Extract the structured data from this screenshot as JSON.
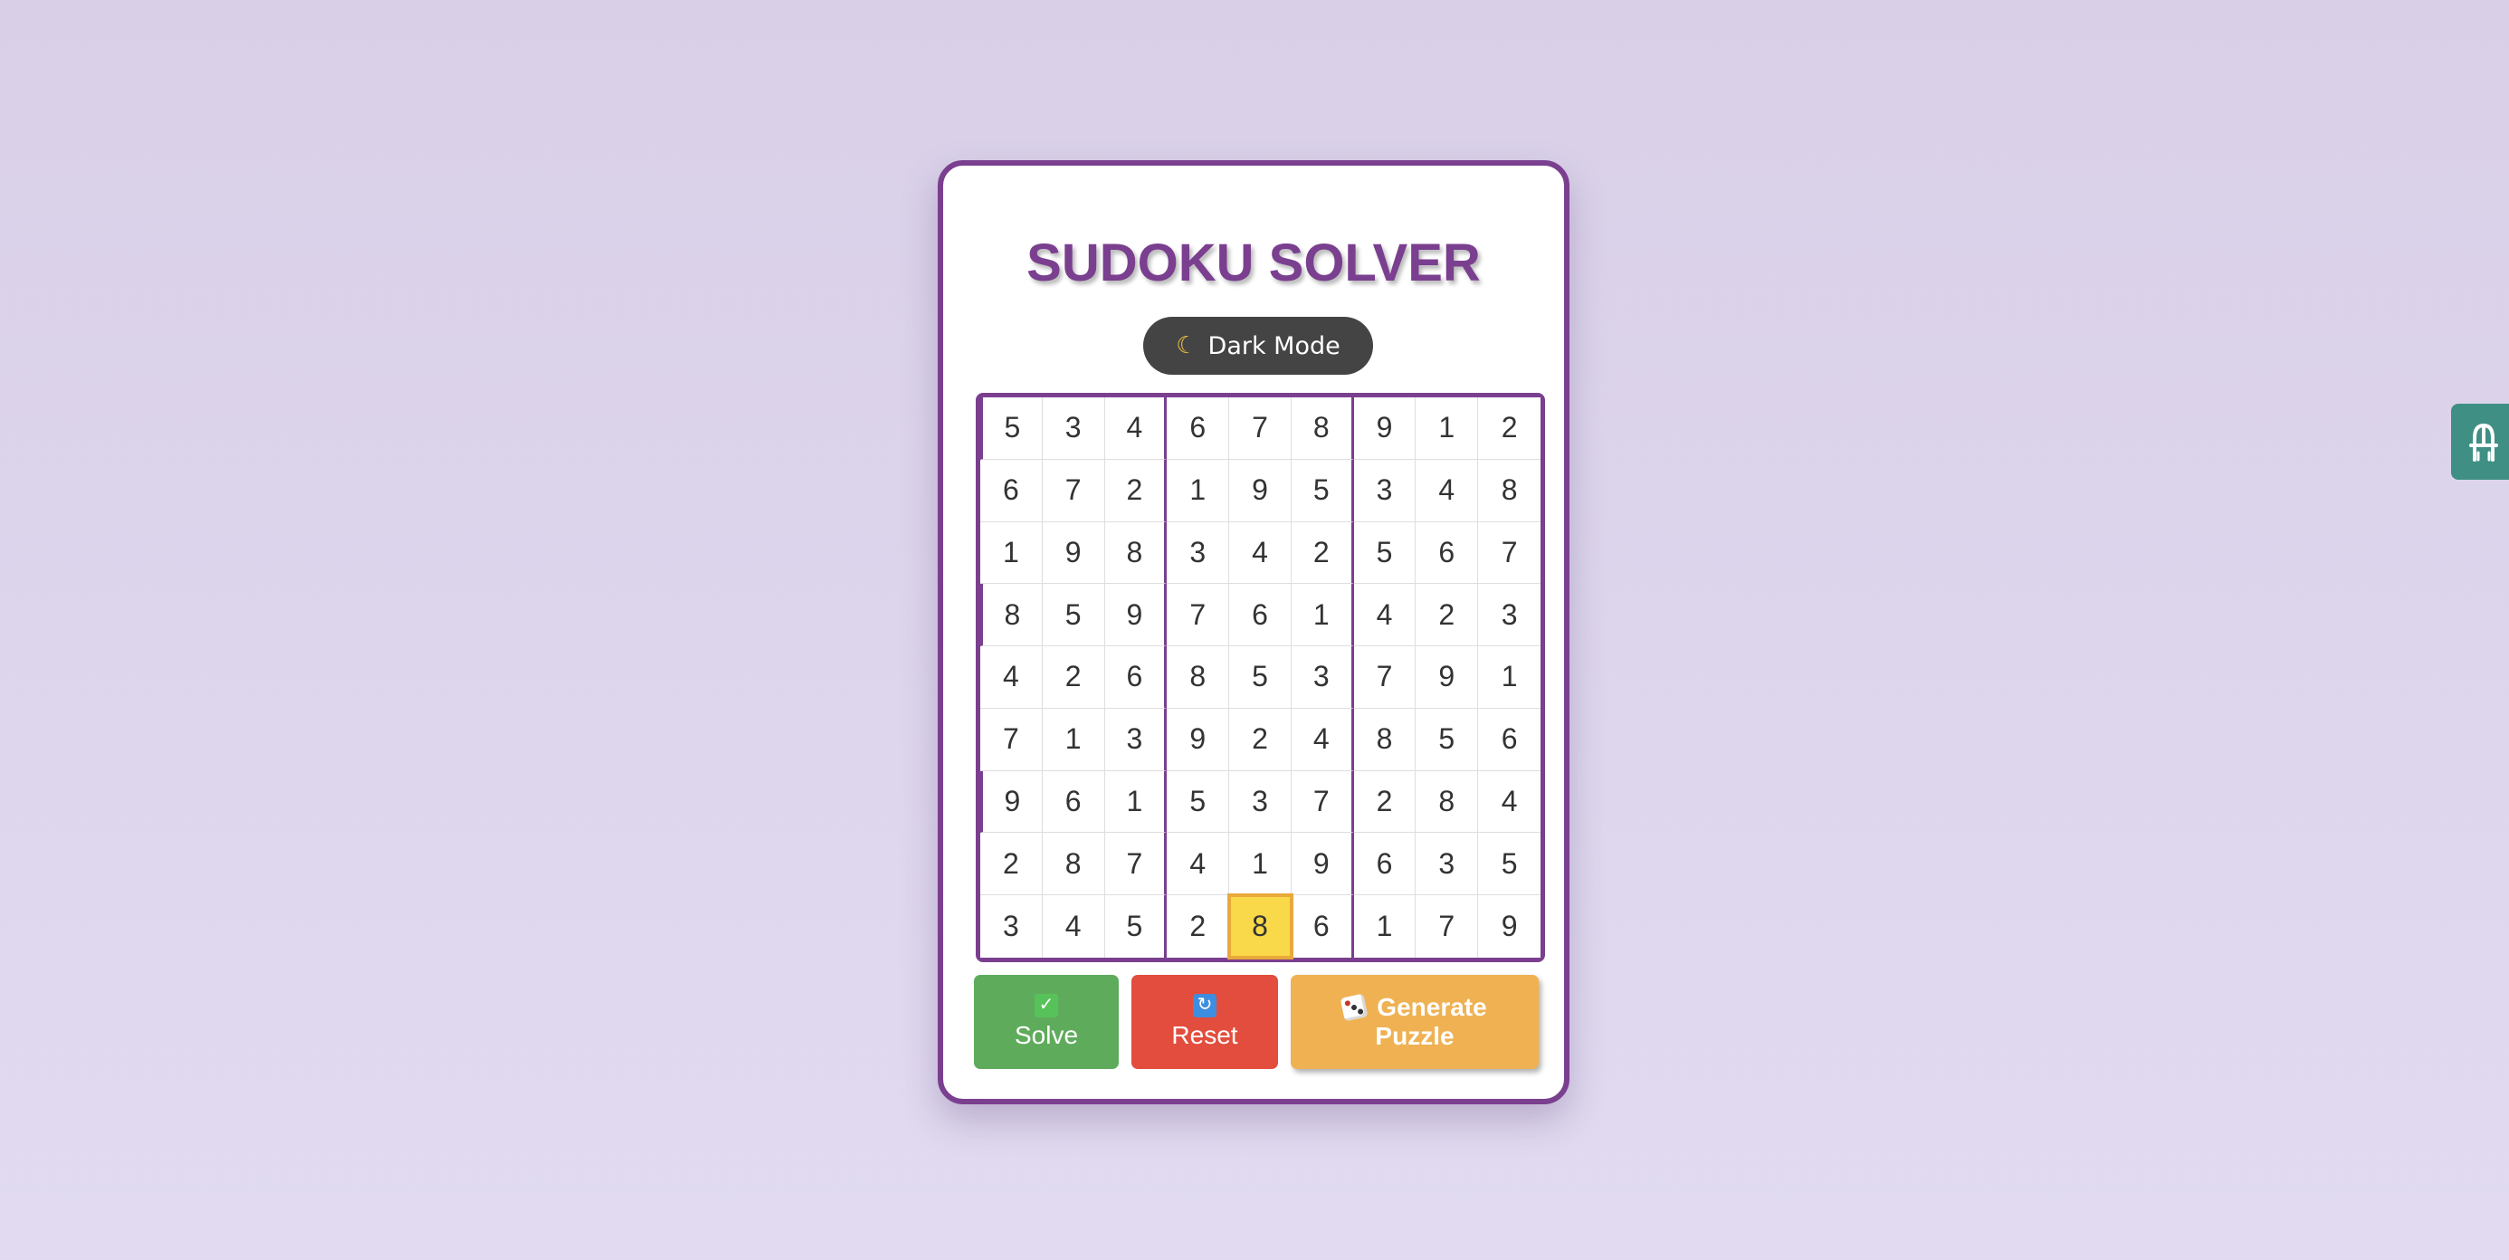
{
  "app": {
    "title": "SUDOKU SOLVER",
    "dark_mode_label": "Dark Mode",
    "dark_mode_icon": "moon-icon"
  },
  "board": {
    "rows": [
      [
        "5",
        "3",
        "4",
        "6",
        "7",
        "8",
        "9",
        "1",
        "2"
      ],
      [
        "6",
        "7",
        "2",
        "1",
        "9",
        "5",
        "3",
        "4",
        "8"
      ],
      [
        "1",
        "9",
        "8",
        "3",
        "4",
        "2",
        "5",
        "6",
        "7"
      ],
      [
        "8",
        "5",
        "9",
        "7",
        "6",
        "1",
        "4",
        "2",
        "3"
      ],
      [
        "4",
        "2",
        "6",
        "8",
        "5",
        "3",
        "7",
        "9",
        "1"
      ],
      [
        "7",
        "1",
        "3",
        "9",
        "2",
        "4",
        "8",
        "5",
        "6"
      ],
      [
        "9",
        "6",
        "1",
        "5",
        "3",
        "7",
        "2",
        "8",
        "4"
      ],
      [
        "2",
        "8",
        "7",
        "4",
        "1",
        "9",
        "6",
        "3",
        "5"
      ],
      [
        "3",
        "4",
        "5",
        "2",
        "8",
        "6",
        "1",
        "7",
        "9"
      ]
    ],
    "selected_row": 9,
    "selected_col": 5
  },
  "buttons": {
    "solve_label": "Solve",
    "solve_icon": "check-icon",
    "reset_label": "Reset",
    "reset_icon": "refresh-icon",
    "generate_label_line1": "Generate",
    "generate_label_line2": "Puzzle",
    "generate_icon": "dice-icon"
  },
  "colors": {
    "accent": "#7a3f8f",
    "solve": "#5fab5c",
    "reset": "#e24d3d",
    "generate": "#efb152",
    "selected_cell": "#f9d84a",
    "side_tab": "#3f8f84"
  },
  "side_tab": {
    "icon": "extension-icon"
  }
}
